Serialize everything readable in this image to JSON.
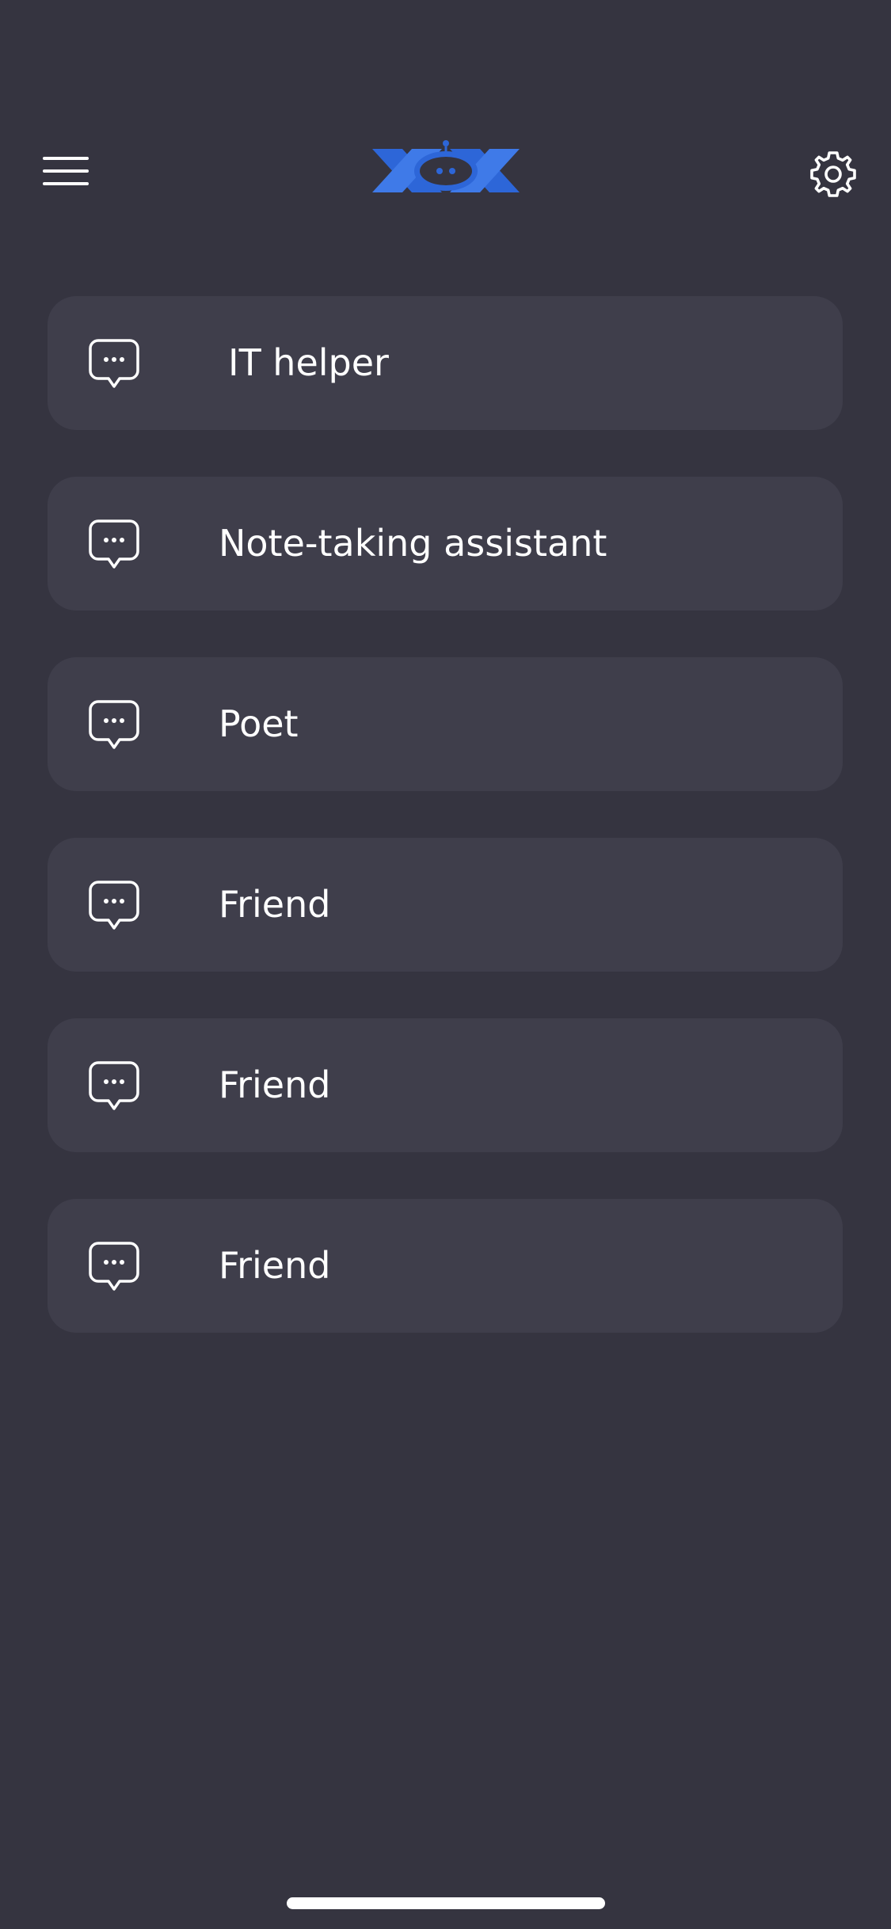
{
  "header": {
    "menu_icon": "hamburger-menu-icon",
    "logo_icon": "app-logo-icon",
    "settings_icon": "gear-icon",
    "accent_color": "#2f6fe0"
  },
  "chats": [
    {
      "label": "IT helper",
      "icon": "chat-bubble-icon"
    },
    {
      "label": "Note-taking assistant",
      "icon": "chat-bubble-icon"
    },
    {
      "label": "Poet",
      "icon": "chat-bubble-icon"
    },
    {
      "label": "Friend",
      "icon": "chat-bubble-icon"
    },
    {
      "label": "Friend",
      "icon": "chat-bubble-icon"
    },
    {
      "label": "Friend",
      "icon": "chat-bubble-icon"
    }
  ],
  "colors": {
    "background": "#353440",
    "card": "#3f3e4b",
    "text": "#ffffff"
  }
}
